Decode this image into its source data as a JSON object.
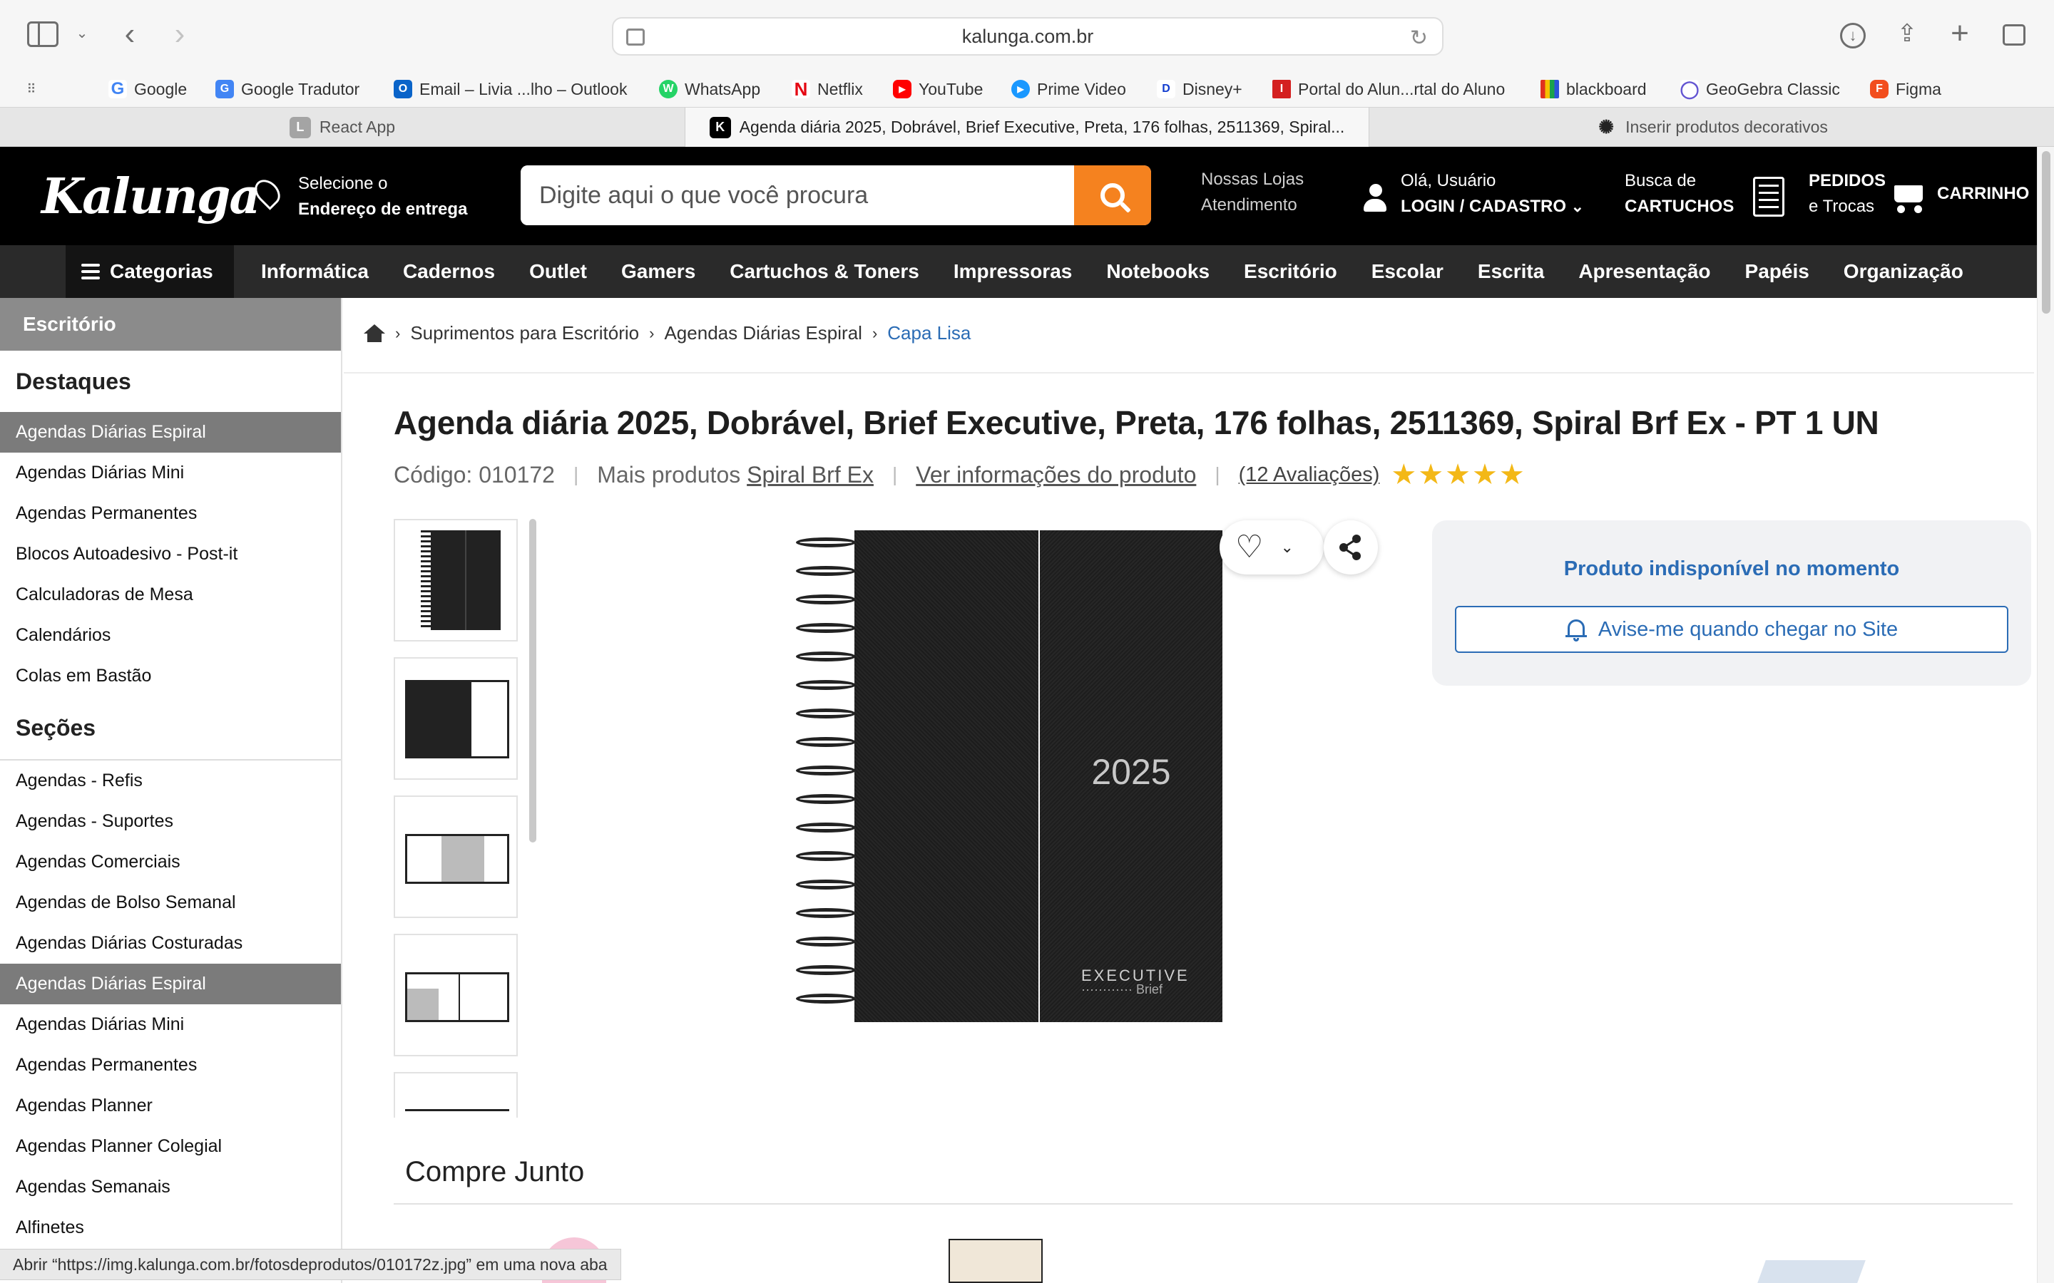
{
  "browser": {
    "url": "kalunga.com.br",
    "bookmarks": [
      {
        "label": "Google",
        "color": "#4285f4",
        "glyph": "G"
      },
      {
        "label": "Google Tradutor",
        "color": "#4285f4",
        "glyph": "G"
      },
      {
        "label": "Email – Livia ...lho – Outlook",
        "color": "#0a64c9",
        "glyph": "O"
      },
      {
        "label": "WhatsApp",
        "color": "#25d366",
        "glyph": "W"
      },
      {
        "label": "Netflix",
        "color": "#e50914",
        "glyph": "N"
      },
      {
        "label": "YouTube",
        "color": "#ff0000",
        "glyph": "▶"
      },
      {
        "label": "Prime Video",
        "color": "#1a98ff",
        "glyph": "▶"
      },
      {
        "label": "Disney+",
        "color": "#113ccf",
        "glyph": "D"
      },
      {
        "label": "Portal do Alun...rtal do Aluno",
        "color": "#d42020",
        "glyph": "I"
      },
      {
        "label": "blackboard",
        "color": "#222222",
        "glyph": "▮"
      },
      {
        "label": "GeoGebra Classic",
        "color": "#6557d2",
        "glyph": "◯"
      },
      {
        "label": "Figma",
        "color": "#f24e1e",
        "glyph": "F"
      }
    ],
    "tabs": [
      {
        "label": "React App",
        "icon": "L"
      },
      {
        "label": "Agenda diária 2025, Dobrável, Brief Executive, Preta, 176 folhas, 2511369, Spiral...",
        "icon": "K"
      },
      {
        "label": "Inserir produtos decorativos",
        "icon": "✺"
      }
    ],
    "status_link": "Abrir “https://img.kalunga.com.br/fotosdeprodutos/010172z.jpg” em uma nova aba"
  },
  "header": {
    "logo": "Kalunga",
    "location_line1": "Selecione o",
    "location_line2": "Endereço de entrega",
    "search_placeholder": "Digite aqui o que você procura",
    "stores": "Nossas Lojas",
    "support": "Atendimento",
    "user_greeting": "Olá, Usuário",
    "login": "LOGIN / CADASTRO",
    "cartridges_line1": "Busca de",
    "cartridges_line2": "CARTUCHOS",
    "orders_line1": "PEDIDOS",
    "orders_line2": "e Trocas",
    "cart": "CARRINHO",
    "accent_color": "#f5821f"
  },
  "nav": {
    "categories": "Categorias",
    "items": [
      "Informática",
      "Cadernos",
      "Outlet",
      "Gamers",
      "Cartuchos & Toners",
      "Impressoras",
      "Notebooks",
      "Escritório",
      "Escolar",
      "Escrita",
      "Apresentação",
      "Papéis",
      "Organização"
    ]
  },
  "sidebar": {
    "header": "Escritório",
    "highlights_title": "Destaques",
    "highlights": [
      "Agendas Diárias Espiral",
      "Agendas Diárias Mini",
      "Agendas Permanentes",
      "Blocos Autoadesivo - Post-it",
      "Calculadoras de Mesa",
      "Calendários",
      "Colas em Bastão"
    ],
    "sections_title": "Seções",
    "sections": [
      "Agendas - Refis",
      "Agendas - Suportes",
      "Agendas Comerciais",
      "Agendas de Bolso Semanal",
      "Agendas Diárias Costuradas",
      "Agendas Diárias Espiral",
      "Agendas Diárias Mini",
      "Agendas Permanentes",
      "Agendas Planner",
      "Agendas Planner Colegial",
      "Agendas Semanais",
      "Alfinetes"
    ]
  },
  "breadcrumb": {
    "items": [
      "Suprimentos para Escritório",
      "Agendas Diárias Espiral"
    ],
    "current": "Capa Lisa"
  },
  "product": {
    "title": "Agenda diária 2025, Dobrável, Brief Executive, Preta, 176 folhas, 2511369, Spiral Brf Ex - PT 1 UN",
    "code_label": "Código: 010172",
    "brand_prefix": "Mais produtos",
    "brand": "Spiral Brf Ex",
    "info_link": "Ver informações do produto",
    "ratings": "(12 Avaliações)",
    "rating_stars": 5,
    "cover_year": "2025",
    "cover_brand": "EXECUTIVE",
    "cover_sub": "Brief",
    "unavailable": "Produto indisponível no momento",
    "notify": "Avise-me quando chegar no Site"
  },
  "buy_together": {
    "title": "Compre Junto"
  }
}
